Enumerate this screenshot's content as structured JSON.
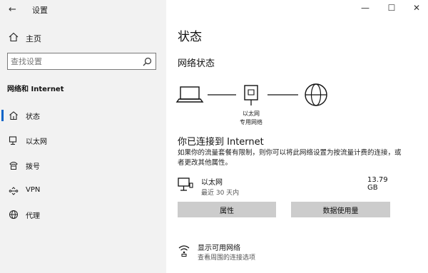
{
  "window": {
    "title": "设置",
    "minimize": "—",
    "maximize": "☐",
    "close": "✕"
  },
  "sidebar": {
    "home_label": "主页",
    "search_placeholder": "查找设置",
    "section_title": "网络和 Internet",
    "items": [
      {
        "label": "状态",
        "icon": "home-wired-status-icon",
        "active": true
      },
      {
        "label": "以太网",
        "icon": "ethernet-icon",
        "active": false
      },
      {
        "label": "拨号",
        "icon": "dialup-icon",
        "active": false
      },
      {
        "label": "VPN",
        "icon": "vpn-icon",
        "active": false
      },
      {
        "label": "代理",
        "icon": "globe-icon",
        "active": false
      }
    ]
  },
  "main": {
    "page_title": "状态",
    "network_status_heading": "网络状态",
    "diagram": {
      "node_label_line1": "以太网",
      "node_label_line2": "专用网络"
    },
    "connected_heading": "你已连接到 Internet",
    "description": "如果你的流量套餐有限制，则你可以将此网络设置为按流量计费的连接，或者更改其他属性。",
    "connection": {
      "name": "以太网",
      "subtitle": "最近 30 天内",
      "usage": "13.79 GB"
    },
    "buttons": {
      "properties": "属性",
      "data_usage": "数据使用量"
    },
    "available_networks": {
      "title": "显示可用网络",
      "subtitle": "查看周围的连接选项"
    }
  },
  "colors": {
    "accent": "#0a64c8",
    "sidebar_bg": "#f2f2f2",
    "button_bg": "#cccccc"
  }
}
